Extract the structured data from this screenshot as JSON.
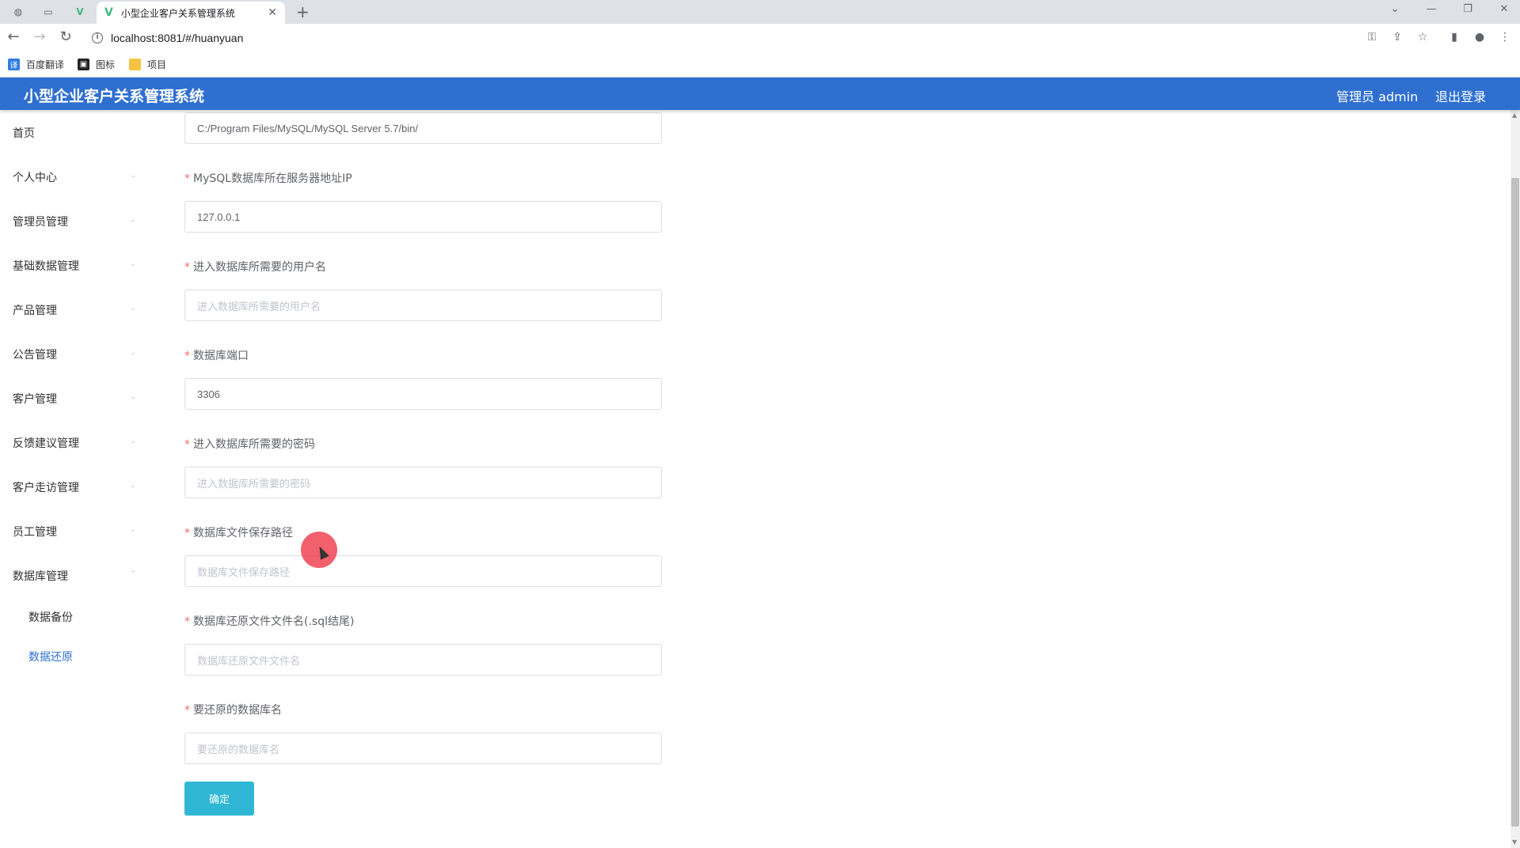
{
  "browser": {
    "tab_title": "小型企业客户关系管理系统",
    "url": "localhost:8081/#/huanyuan",
    "bookmarks": [
      "百度翻译",
      "图标",
      "项目"
    ]
  },
  "header": {
    "app_title": "小型企业客户关系管理系统",
    "admin_label": "管理员 admin",
    "logout_label": "退出登录"
  },
  "sidebar": {
    "items": [
      {
        "label": "首页",
        "has_arrow": false
      },
      {
        "label": "个人中心",
        "has_arrow": true
      },
      {
        "label": "管理员管理",
        "has_arrow": true
      },
      {
        "label": "基础数据管理",
        "has_arrow": true
      },
      {
        "label": "产品管理",
        "has_arrow": true
      },
      {
        "label": "公告管理",
        "has_arrow": true
      },
      {
        "label": "客户管理",
        "has_arrow": true
      },
      {
        "label": "反馈建议管理",
        "has_arrow": true
      },
      {
        "label": "客户走访管理",
        "has_arrow": true
      },
      {
        "label": "员工管理",
        "has_arrow": true
      },
      {
        "label": "数据库管理",
        "has_arrow": true
      }
    ],
    "sub_items": [
      {
        "label": "数据备份",
        "active": false
      },
      {
        "label": "数据还原",
        "active": true
      }
    ]
  },
  "form": {
    "top_input_value": "C:/Program Files/MySQL/MySQL Server 5.7/bin/",
    "fields": [
      {
        "label": "MySQL数据库所在服务器地址IP",
        "value": "127.0.0.1",
        "placeholder": ""
      },
      {
        "label": "进入数据库所需要的用户名",
        "value": "",
        "placeholder": "进入数据库所需要的用户名"
      },
      {
        "label": "数据库端口",
        "value": "3306",
        "placeholder": ""
      },
      {
        "label": "进入数据库所需要的密码",
        "value": "",
        "placeholder": "进入数据库所需要的密码"
      },
      {
        "label": "数据库文件保存路径",
        "value": "",
        "placeholder": "数据库文件保存路径"
      },
      {
        "label": "数据库还原文件文件名(.sql结尾)",
        "value": "",
        "placeholder": "数据库还原文件文件名"
      },
      {
        "label": "要还原的数据库名",
        "value": "",
        "placeholder": "要还原的数据库名"
      }
    ],
    "required_mark": "*",
    "submit_label": "确定"
  },
  "colors": {
    "header_bg": "#2f6fd0",
    "button_bg": "#30b7d5",
    "active_link": "#2f6fd0",
    "required": "#f56c6c"
  }
}
